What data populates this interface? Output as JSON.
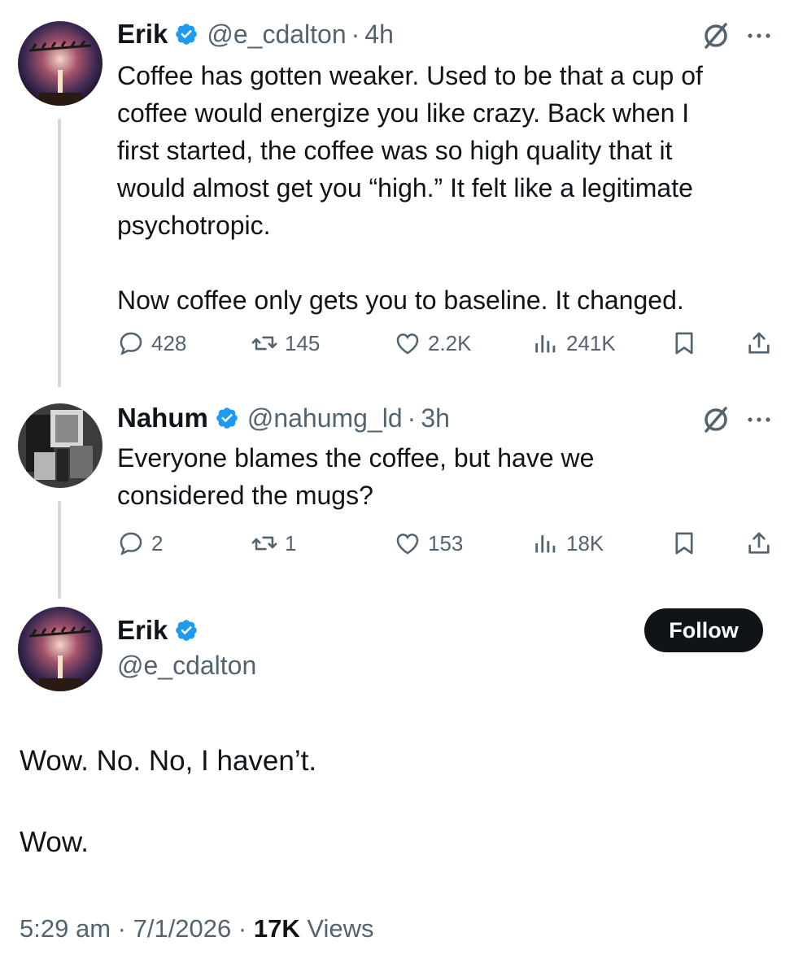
{
  "colors": {
    "text": "#0f1419",
    "secondary": "#536471",
    "verified": "#1d9bf0",
    "thread_line": "#cfd9de",
    "follow_bg": "#0f1419"
  },
  "tweets": [
    {
      "name": "Erik",
      "handle": "@e_cdalton",
      "separator": "·",
      "time": "4h",
      "lines": [
        "Coffee has gotten weaker. Used to be that a cup of",
        "coffee would energize you like crazy. Back when I",
        "first started, the coffee was so high quality that it",
        "would almost get you “high.” It felt like a legitimate",
        "psychotropic.",
        "Now coffee only gets you to baseline. It changed."
      ],
      "replies": "428",
      "reposts": "145",
      "likes": "2.2K",
      "views": "241K"
    },
    {
      "name": "Nahum",
      "handle": "@nahumg_ld",
      "separator": "·",
      "time": "3h",
      "lines": [
        "Everyone blames the coffee, but have we",
        "considered the mugs?"
      ],
      "replies": "2",
      "reposts": "1",
      "likes": "153",
      "views": "18K"
    }
  ],
  "main_tweet": {
    "name": "Erik",
    "handle": "@e_cdalton",
    "follow_label": "Follow",
    "lines": [
      "Wow. No. No, I haven’t.",
      "Wow."
    ],
    "time": "5:29 am",
    "separator": "·",
    "date": "7/1/2026",
    "views_count": "17K",
    "views_label": "Views"
  },
  "icons": {
    "verified": "verified-badge-icon",
    "grok": "grok-icon",
    "more": "more-icon",
    "reply": "reply-icon",
    "repost": "repost-icon",
    "like": "heart-icon",
    "views": "views-icon",
    "bookmark": "bookmark-icon",
    "share": "share-icon"
  }
}
